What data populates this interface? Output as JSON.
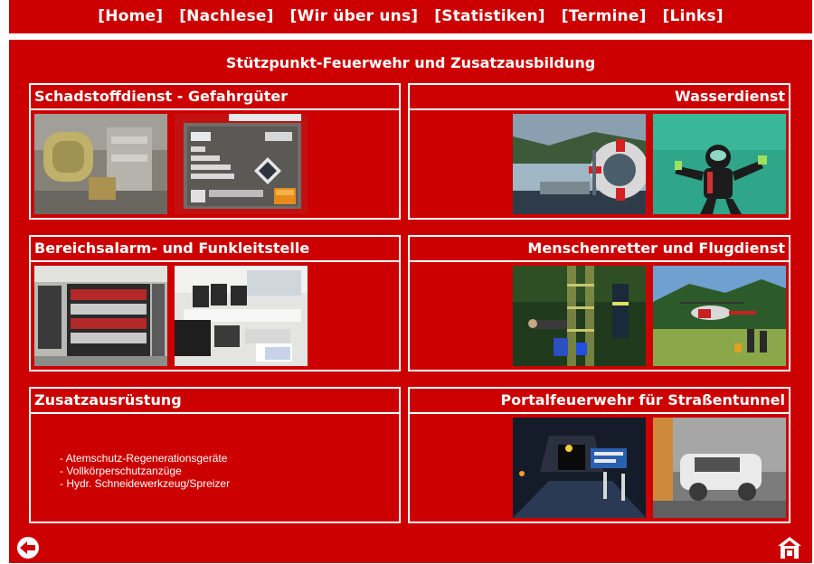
{
  "nav": {
    "items": [
      "[Home]",
      "[Nachlese]",
      "[Wir über uns]",
      "[Statistiken]",
      "[Termine]",
      "[Links]"
    ]
  },
  "page_title": "Stützpunkt-Feuerwehr und Zusatzausbildung",
  "panels": [
    {
      "title": "Schadstoffdienst - Gefahrgüter",
      "photos": [
        "photo-hazmat-training-room",
        "photo-railcar-hazard-plate"
      ]
    },
    {
      "title": "Wasserdienst",
      "photos": [
        "photo-river-rescue-lifebuoy",
        "photo-diver-underwater"
      ]
    },
    {
      "title": "Bereichsalarm- und Funkleitstelle",
      "photos": [
        "photo-equipment-storage-room",
        "photo-dispatch-workstations"
      ]
    },
    {
      "title": "Menschenretter und Flugdienst",
      "photos": [
        "photo-night-rescue-ladder",
        "photo-helicopter-landing"
      ]
    },
    {
      "title": "Zusatzausrüstung",
      "items": [
        "- Atemschutz-Regenerationsgeräte",
        "- Vollkörperschutzanzüge",
        "- Hydr. Schneidewerkzeug/Spreizer"
      ]
    },
    {
      "title": "Portalfeuerwehr für Straßentunnel",
      "photos": [
        "photo-tunnel-portal-night",
        "photo-tunnel-car-smoke"
      ]
    }
  ],
  "icons": {
    "back": "back-arrow-icon",
    "home": "home-icon"
  },
  "colors": {
    "background": "#cc0000",
    "text": "#ffffff"
  }
}
